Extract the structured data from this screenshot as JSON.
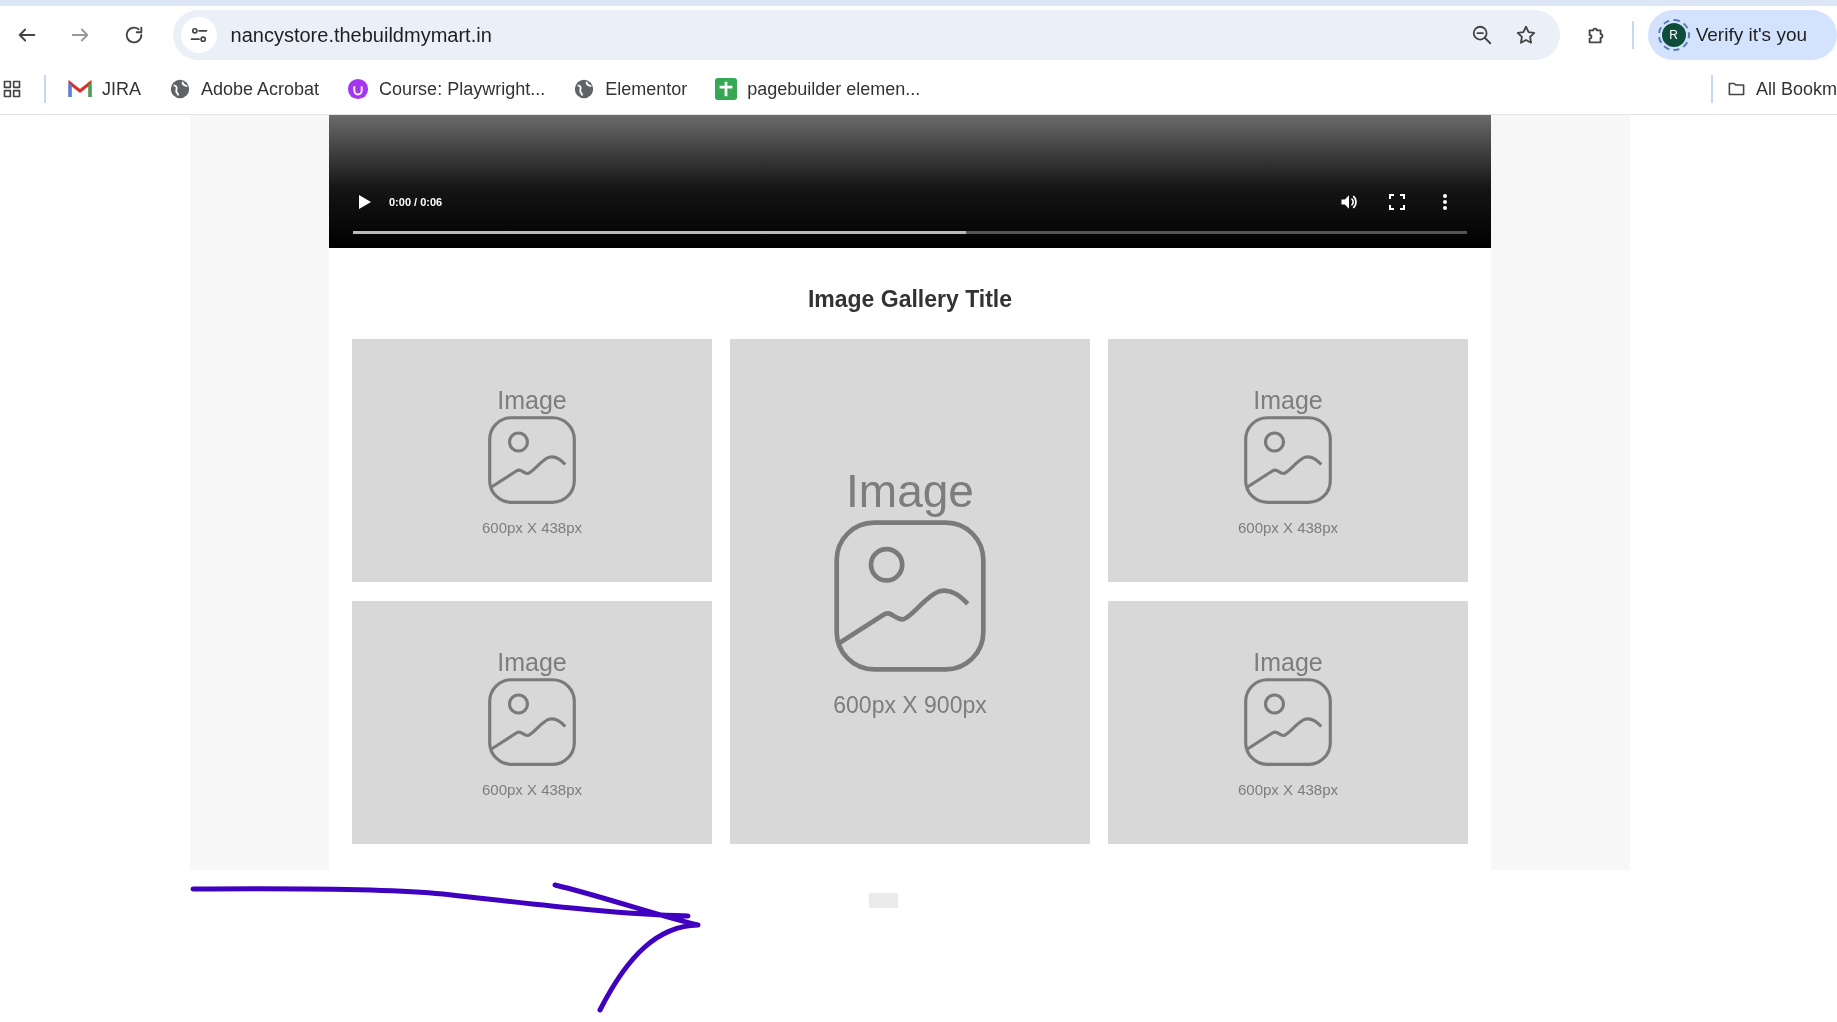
{
  "browser": {
    "url": "nancystore.thebuildmymart.in",
    "profile": {
      "initial": "R",
      "label": "Verify it's you"
    },
    "bookmarks": [
      {
        "label": "JIRA",
        "kind": "mail"
      },
      {
        "label": "Adobe Acrobat",
        "kind": "globe"
      },
      {
        "label": "Course: Playwright...",
        "kind": "course"
      },
      {
        "label": "Elementor",
        "kind": "globe"
      },
      {
        "label": "pagebuilder elemen...",
        "kind": "sheet"
      }
    ],
    "all_bookmarks": "All Bookm"
  },
  "video": {
    "time": "0:00 / 0:06",
    "buffered": {
      "level": 0.55
    }
  },
  "gallery": {
    "title": "Image Gallery Title",
    "tiles": [
      {
        "kind": "small",
        "label": "Image",
        "size": "600px X 438px"
      },
      {
        "kind": "large",
        "label": "Image",
        "size": "600px X 900px"
      },
      {
        "kind": "small",
        "label": "Image",
        "size": "600px X 438px"
      },
      {
        "kind": "small",
        "label": "Image",
        "size": "600px X 438px"
      },
      {
        "kind": "small",
        "label": "Image",
        "size": "600px X 438px"
      }
    ]
  }
}
